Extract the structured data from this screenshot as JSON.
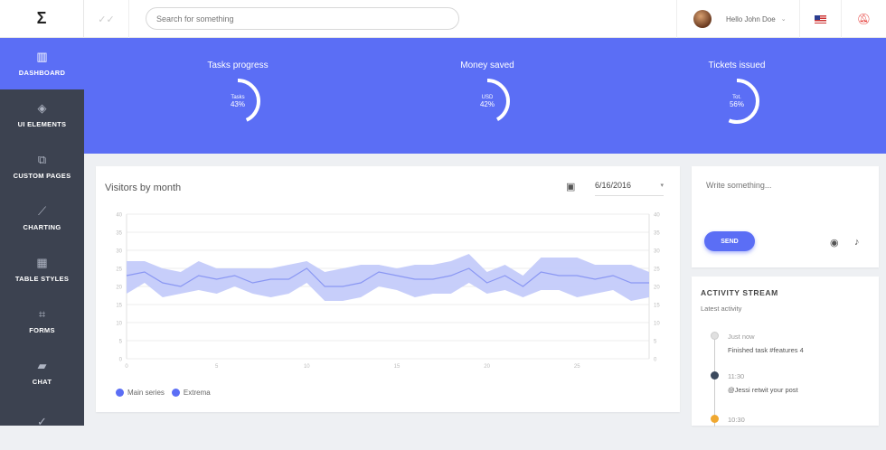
{
  "logo": "Σ",
  "sidebar": {
    "items": [
      {
        "label": "DASHBOARD",
        "icon": "bar-chart-icon",
        "glyph": "▥",
        "active": true
      },
      {
        "label": "UI ELEMENTS",
        "icon": "layers-icon",
        "glyph": "◈"
      },
      {
        "label": "CUSTOM PAGES",
        "icon": "pages-icon",
        "glyph": "⧉"
      },
      {
        "label": "CHARTING",
        "icon": "trending-icon",
        "glyph": "⟋"
      },
      {
        "label": "TABLE STYLES",
        "icon": "grid-icon",
        "glyph": "▦"
      },
      {
        "label": "FORMS",
        "icon": "crop-icon",
        "glyph": "⌗"
      },
      {
        "label": "CHAT",
        "icon": "chat-icon",
        "glyph": "▰"
      },
      {
        "label": "",
        "icon": "check-all-icon",
        "glyph": "✓"
      }
    ]
  },
  "topbar": {
    "search_placeholder": "Search for something",
    "user_name": "Hello John Doe"
  },
  "banner": {
    "stats": [
      {
        "title": "Tasks progress",
        "label": "Tasks",
        "value": "43%",
        "percent": 43
      },
      {
        "title": "Money saved",
        "label": "USD",
        "value": "42%",
        "percent": 42
      },
      {
        "title": "Tickets issued",
        "label": "Tot.",
        "value": "56%",
        "percent": 56
      }
    ]
  },
  "chart_card": {
    "title": "Visitors by month",
    "date": "6/16/2016",
    "legend": [
      "Main series",
      "Extrema"
    ]
  },
  "chart_data": {
    "type": "area",
    "x": [
      0,
      1,
      2,
      3,
      4,
      5,
      6,
      7,
      8,
      9,
      10,
      11,
      12,
      13,
      14,
      15,
      16,
      17,
      18,
      19,
      20,
      21,
      22,
      23,
      24,
      25,
      26,
      27,
      28,
      29
    ],
    "xticks": [
      0,
      5,
      10,
      15,
      20,
      25
    ],
    "ylim": [
      0,
      40
    ],
    "yticks": [
      0,
      5,
      10,
      15,
      20,
      25,
      30,
      35,
      40
    ],
    "series": [
      {
        "name": "Main series",
        "values": [
          23,
          24,
          21,
          20,
          23,
          22,
          23,
          21,
          22,
          22,
          25,
          20,
          20,
          21,
          24,
          23,
          22,
          22,
          23,
          25,
          21,
          23,
          20,
          24,
          23,
          23,
          22,
          23,
          21,
          21
        ]
      },
      {
        "name": "Extrema",
        "low": [
          18,
          21,
          17,
          18,
          19,
          18,
          20,
          18,
          17,
          18,
          21,
          16,
          16,
          17,
          20,
          19,
          17,
          18,
          18,
          21,
          18,
          19,
          17,
          19,
          19,
          17,
          18,
          19,
          16,
          17
        ],
        "high": [
          27,
          27,
          25,
          24,
          27,
          25,
          25,
          25,
          25,
          26,
          27,
          24,
          25,
          26,
          26,
          25,
          26,
          26,
          27,
          29,
          24,
          26,
          23,
          28,
          28,
          28,
          26,
          26,
          26,
          24
        ]
      }
    ],
    "grid": true
  },
  "write_card": {
    "placeholder": "Write something...",
    "send_label": "SEND"
  },
  "activity": {
    "title": "ACTIVITY STREAM",
    "subtitle": "Latest activity",
    "items": [
      {
        "time": "Just now",
        "text": "Finished task #features 4",
        "color": "#e0e0e0"
      },
      {
        "time": "11:30",
        "text": "@Jessi retwit your post",
        "color": "#3c4a5e"
      },
      {
        "time": "10:30",
        "text": "",
        "color": "#f0a830"
      }
    ]
  },
  "colors": {
    "accent": "#5b6ef5",
    "sidebar": "#3c4250",
    "band": "#c4cbfa"
  }
}
